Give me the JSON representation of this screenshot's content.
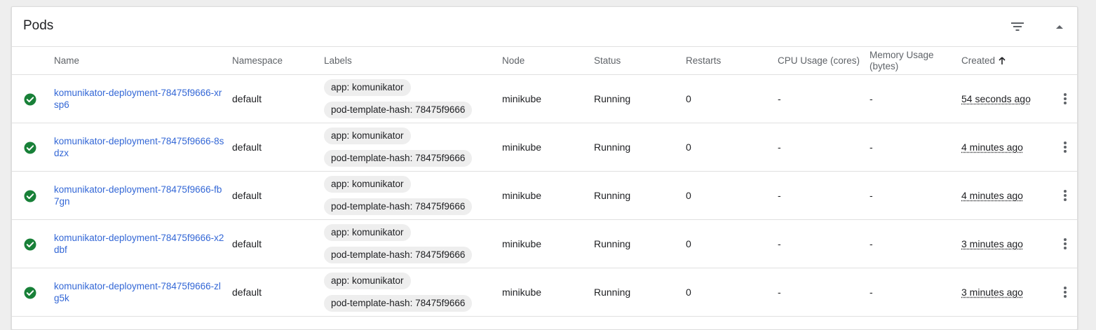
{
  "card": {
    "title": "Pods"
  },
  "columns": {
    "name": "Name",
    "namespace": "Namespace",
    "labels": "Labels",
    "node": "Node",
    "status": "Status",
    "restarts": "Restarts",
    "cpu": "CPU Usage (cores)",
    "memory_line1": "Memory Usage",
    "memory_line2": "(bytes)",
    "created": "Created"
  },
  "icons": {
    "filter": "filter-icon",
    "collapse": "collapse-up-icon",
    "status": "check-circle-icon",
    "sort": "arrow-up-icon",
    "menu": "more-vert-icon"
  },
  "colors": {
    "status_ok": "#188038",
    "link": "#3367d6",
    "header_text": "#5f6368"
  },
  "rows": [
    {
      "name": "komunikator-deployment-78475f9666-xrsp6",
      "namespace": "default",
      "labels": [
        "app: komunikator",
        "pod-template-hash: 78475f9666"
      ],
      "node": "minikube",
      "status": "Running",
      "restarts": "0",
      "cpu": "-",
      "memory": "-",
      "created": "54 seconds ago"
    },
    {
      "name": "komunikator-deployment-78475f9666-8sdzx",
      "namespace": "default",
      "labels": [
        "app: komunikator",
        "pod-template-hash: 78475f9666"
      ],
      "node": "minikube",
      "status": "Running",
      "restarts": "0",
      "cpu": "-",
      "memory": "-",
      "created": "4 minutes ago"
    },
    {
      "name": "komunikator-deployment-78475f9666-fb7gn",
      "namespace": "default",
      "labels": [
        "app: komunikator",
        "pod-template-hash: 78475f9666"
      ],
      "node": "minikube",
      "status": "Running",
      "restarts": "0",
      "cpu": "-",
      "memory": "-",
      "created": "4 minutes ago"
    },
    {
      "name": "komunikator-deployment-78475f9666-x2dbf",
      "namespace": "default",
      "labels": [
        "app: komunikator",
        "pod-template-hash: 78475f9666"
      ],
      "node": "minikube",
      "status": "Running",
      "restarts": "0",
      "cpu": "-",
      "memory": "-",
      "created": "3 minutes ago"
    },
    {
      "name": "komunikator-deployment-78475f9666-zlg5k",
      "namespace": "default",
      "labels": [
        "app: komunikator",
        "pod-template-hash: 78475f9666"
      ],
      "node": "minikube",
      "status": "Running",
      "restarts": "0",
      "cpu": "-",
      "memory": "-",
      "created": "3 minutes ago"
    }
  ]
}
